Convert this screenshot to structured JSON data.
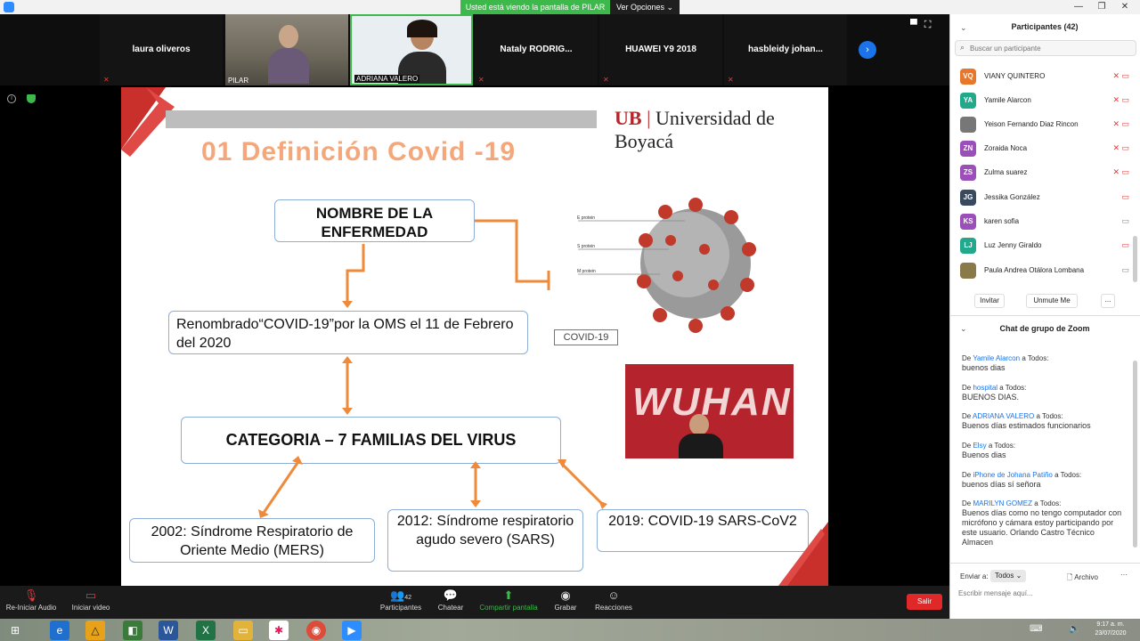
{
  "window": {
    "share_banner": "Usted está viendo la pantalla de PILAR",
    "view_options": "Ver Opciones",
    "minimize": "—",
    "restore": "❐",
    "close": "✕"
  },
  "participants_strip": [
    {
      "name": "laura oliveros",
      "video": false
    },
    {
      "name": "PILAR",
      "video": true
    },
    {
      "name": "ADRIANA VALERO",
      "video": true
    },
    {
      "name": "Nataly  RODRIG...",
      "video": false
    },
    {
      "name": "HUAWEI Y9 2018",
      "video": false
    },
    {
      "name": "hasbleidy  johan...",
      "video": false
    }
  ],
  "slide": {
    "university": "Universidad de Boyacá",
    "logo_mark": "UB",
    "title": "01 Definición Covid -19",
    "box_name": "NOMBRE DE LA ENFERMEDAD",
    "box_renamed": "Renombrado“COVID-19”por la OMS el 11 de Febrero del 2020",
    "box_category": "CATEGORIA – 7 FAMILIAS DEL VIRUS",
    "box_mers": "2002: Síndrome Respiratorio de Oriente Medio (MERS)",
    "box_sars": "2012: Síndrome respiratorio agudo severo (SARS)",
    "box_covid": "2019: COVID-19 SARS-CoV2",
    "virus_labels": [
      "E protein",
      "S protein",
      "M protein"
    ],
    "covid_tag": "COVID-19",
    "wuhan_text": "WUHAN"
  },
  "toolbar": {
    "audio": "Re-Iniciar Audio",
    "video": "Iniciar video",
    "participants": "Participantes",
    "participants_count": "42",
    "chat": "Chatear",
    "share": "Compartir pantalla",
    "record": "Grabar",
    "reactions": "Reacciones",
    "leave": "Salir"
  },
  "panel": {
    "title": "Participantes (42)",
    "search_placeholder": "Buscar un participante",
    "participants": [
      {
        "initials": "VQ",
        "name": "VIANY QUINTERO",
        "color": "#e8772e"
      },
      {
        "initials": "YA",
        "name": "Yamile Alarcon",
        "color": "#22a88a"
      },
      {
        "initials": "",
        "name": "Yeison Fernando Diaz Rincon",
        "color": "#777777"
      },
      {
        "initials": "ZN",
        "name": "Zoraida Noca",
        "color": "#9b4fb8"
      },
      {
        "initials": "ZS",
        "name": "Zulma suarez",
        "color": "#9b4fb8"
      },
      {
        "initials": "JG",
        "name": "Jessika González",
        "color": "#3a4a5e"
      },
      {
        "initials": "KS",
        "name": "karen sofia",
        "color": "#9b4fb8"
      },
      {
        "initials": "LJ",
        "name": "Luz Jenny Giraldo",
        "color": "#22a88a"
      },
      {
        "initials": "",
        "name": "Paula Andrea Otálora Lombana",
        "color": "#8a7a4a"
      }
    ],
    "invite": "Invitar",
    "unmute": "Unmute Me",
    "more": "...",
    "chat_title": "Chat de grupo de Zoom",
    "chat": [
      {
        "from": "Yamile Alarcon",
        "msg": "buenos dias"
      },
      {
        "from": "hospital",
        "msg": "BUENOS DIAS."
      },
      {
        "from": "ADRIANA VALERO",
        "msg": "Buenos días estimados funcionarios"
      },
      {
        "from": "Elsy",
        "msg": "Buenos dias"
      },
      {
        "from": "iPhone de Johana Patiño",
        "msg": "buenos días sí señora"
      },
      {
        "from": "MARILYN GOMEZ",
        "msg": "Buenos días como no tengo computador con micrófono y cámara estoy participando por este usuario. Orlando Castro Técnico Almacen"
      }
    ],
    "chat_prefix": "De",
    "chat_to": "a Todos:",
    "send_to_label": "Enviar a:",
    "send_to_value": "Todos",
    "file_label": "Archivo",
    "message_placeholder": "Escribir mensaje aquí..."
  },
  "taskbar": {
    "time": "9:17 a. m.",
    "date": "23/07/2020"
  }
}
